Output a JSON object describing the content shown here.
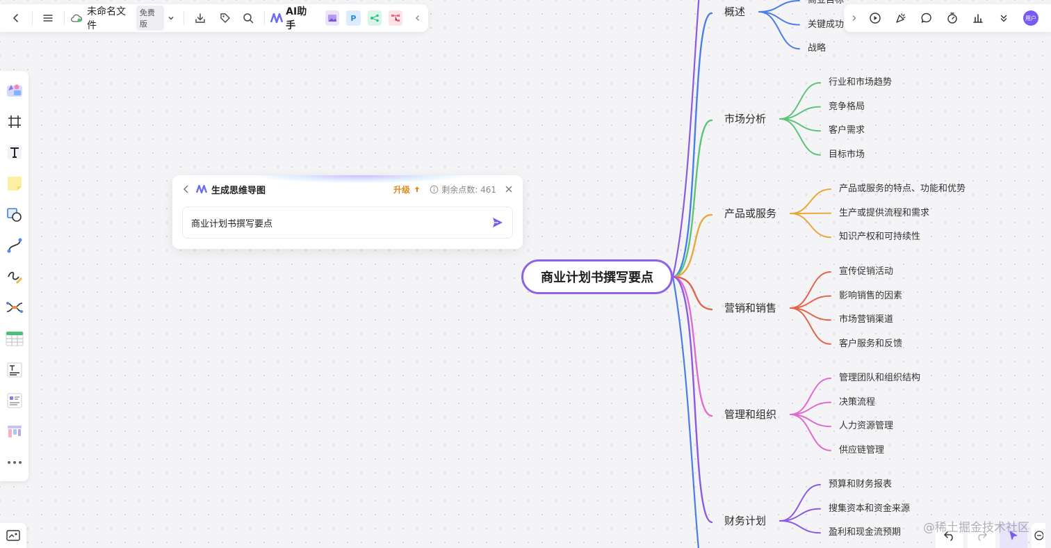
{
  "toolbar": {
    "file_name": "未命名文件",
    "plan_badge": "免费版",
    "ai_assistant_label": "AI助手"
  },
  "avatar_text": "用户",
  "ai_panel": {
    "title": "生成思维导图",
    "upgrade_label": "升级",
    "points_label": "剩余点数: 461",
    "input_value": "商业计划书撰写要点"
  },
  "mindmap": {
    "root": "商业计划书撰写要点",
    "branches": [
      {
        "label": "概述",
        "color": "#4a7de8",
        "children": [
          "商业目标",
          "关键成功因素",
          "战略"
        ]
      },
      {
        "label": "市场分析",
        "color": "#5cc47a",
        "children": [
          "行业和市场趋势",
          "竞争格局",
          "客户需求",
          "目标市场"
        ]
      },
      {
        "label": "产品或服务",
        "color": "#e8a83a",
        "children": [
          "产品或服务的特点、功能和优势",
          "生产或提供流程和需求",
          "知识产权和可持续性"
        ]
      },
      {
        "label": "营销和销售",
        "color": "#e2644a",
        "children": [
          "宣传促销活动",
          "影响销售的因素",
          "市场营销渠道",
          "客户服务和反馈"
        ]
      },
      {
        "label": "管理和组织",
        "color": "#e06ad2",
        "children": [
          "管理团队和组织结构",
          "决策流程",
          "人力资源管理",
          "供应链管理"
        ]
      },
      {
        "label": "财务计划",
        "color": "#8a5ae2",
        "children": [
          "预算和财务报表",
          "搜集资本和资金来源",
          "盈利和现金流预期"
        ]
      }
    ],
    "partial_top_child": "商业目标",
    "partial_top_child_color": "#4a7de8"
  },
  "watermark": "@稀土掘金技术社区",
  "colors": {
    "root_border": "#8e62e6",
    "accent": "#7a5af5",
    "upgrade": "#e08a1e"
  }
}
